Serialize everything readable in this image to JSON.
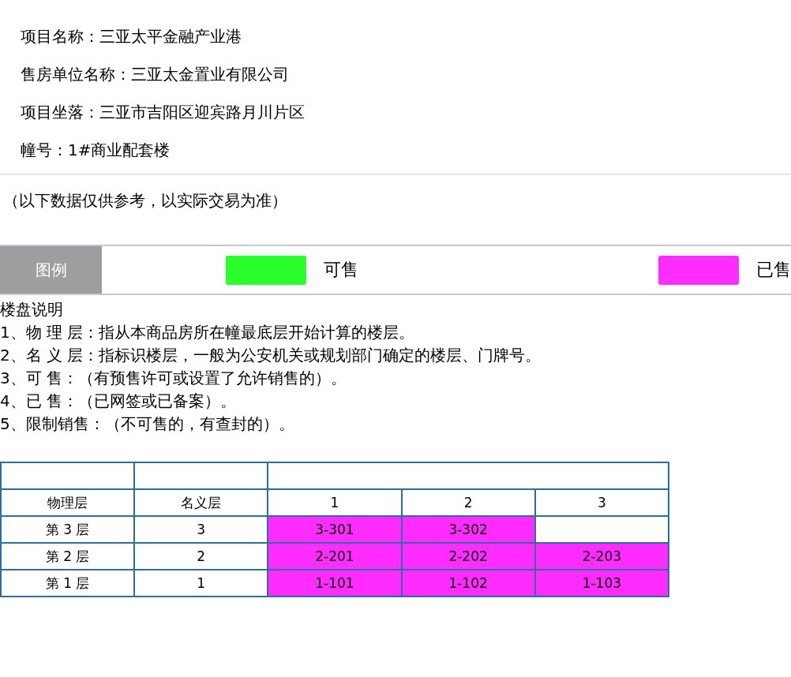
{
  "info": [
    "项目名称：三亚太平金融产业港",
    "售房单位名称：三亚太金置业有限公司",
    "项目坐落：三亚市吉阳区迎宾路月川片区",
    "幢号：1#商业配套楼"
  ],
  "disclaimer": "（以下数据仅供参考，以实际交易为准）",
  "legend": {
    "title": "图例",
    "items": [
      {
        "label": "可售",
        "color": "#2bff2b"
      },
      {
        "label": "已售",
        "color": "#ff2cff"
      }
    ]
  },
  "notes": {
    "title": "楼盘说明",
    "items": [
      "1、物 理 层：指从本商品房所在幢最底层开始计算的楼层。",
      "2、名 义 层：指标识楼层，一般为公安机关或规划部门确定的楼层、门牌号。",
      "3、可 售：（有预售许可或设置了允许销售的）。",
      "4、已 售：（已网签或已备案）。",
      "5、限制销售：（不可售的，有查封的）。"
    ]
  },
  "table": {
    "columns": [
      "物理层",
      "名义层",
      "1",
      "2",
      "3"
    ],
    "rows": [
      {
        "physical": "第 3 层",
        "nominal": "3",
        "units": [
          {
            "kind": "unit",
            "label": "3-301",
            "color": "#ff2cff"
          },
          {
            "kind": "unit",
            "label": "3-302",
            "color": "#ff2cff"
          },
          {
            "kind": "empty"
          }
        ]
      },
      {
        "physical": "第 2 层",
        "nominal": "2",
        "units": [
          {
            "kind": "unit",
            "label": "2-201",
            "color": "#ff2cff"
          },
          {
            "kind": "unit",
            "label": "2-202",
            "color": "#ff2cff"
          },
          {
            "kind": "unit",
            "label": "2-203",
            "color": "#ff2cff"
          }
        ]
      },
      {
        "physical": "第 1 层",
        "nominal": "1",
        "units": [
          {
            "kind": "unit",
            "label": "1-101",
            "color": "#ff2cff"
          },
          {
            "kind": "unit",
            "label": "1-102",
            "color": "#ff2cff"
          },
          {
            "kind": "unit",
            "label": "1-103",
            "color": "#ff2cff"
          }
        ]
      }
    ]
  }
}
